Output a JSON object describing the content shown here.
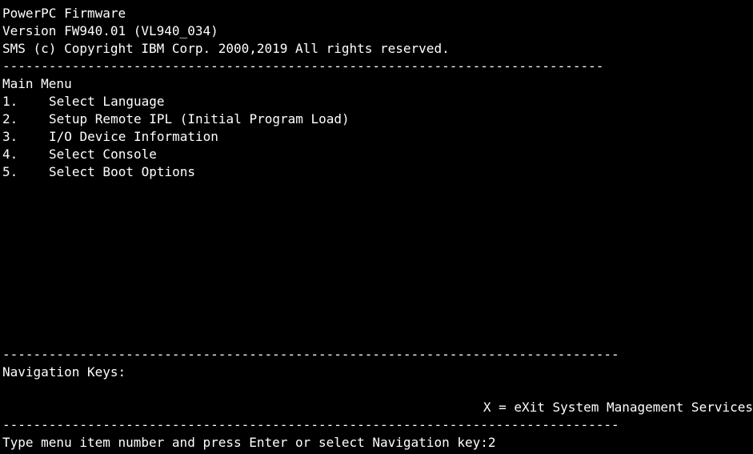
{
  "header": {
    "line1": "PowerPC Firmware",
    "line2": "Version FW940.01 (VL940_034)",
    "line3": "SMS (c) Copyright IBM Corp. 2000,2019 All rights reserved."
  },
  "separator": "------------------------------------------------------------------------------",
  "separator_full": "--------------------------------------------------------------------------------",
  "menu": {
    "title": "Main Menu",
    "items": [
      {
        "number": "1.",
        "label": "Select Language"
      },
      {
        "number": "2.",
        "label": "Setup Remote IPL (Initial Program Load)"
      },
      {
        "number": "3.",
        "label": "I/O Device Information"
      },
      {
        "number": "4.",
        "label": "Select Console"
      },
      {
        "number": "5.",
        "label": "Select Boot Options"
      }
    ]
  },
  "navigation": {
    "title": "Navigation Keys:",
    "exit_key": "X = eXit System Management Services"
  },
  "prompt": {
    "text": "Type menu item number and press Enter or select Navigation key:",
    "value": "2"
  },
  "colors": {
    "background": "#000000",
    "foreground": "#ffffff"
  }
}
